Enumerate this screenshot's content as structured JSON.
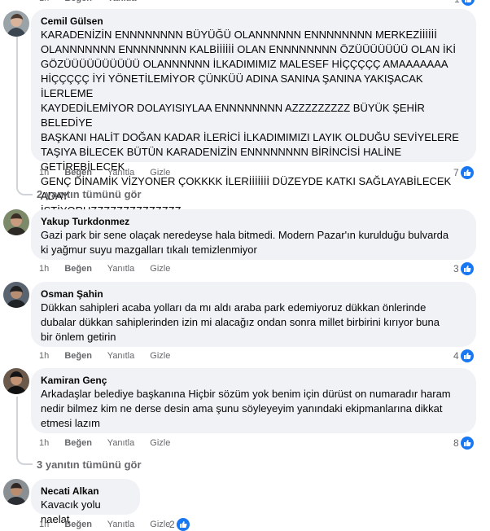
{
  "top_partial": {
    "count": "1"
  },
  "actions": {
    "like": "Beğen",
    "reply": "Yanıtla",
    "hide": "Gizle"
  },
  "comments": [
    {
      "author": "Cemil Gülsen",
      "text": "KARADENİZİN ENNNNNNNN BÜYÜĞÜ OLANNNNNN ENNNNNNNN MERKEZİİİİİİ\nOLANNNNNNN ENNNNNNNN KALBİİİİİİ OLAN ENNNNNNNN ÖZÜÜÜÜÜÜÜ OLAN İKİ\nGÖZÜÜÜÜÜÜÜÜÜÜ OLANNNNNN İLKADIMIMIZ MALESEF HİÇÇÇÇÇ AMAAAAAAA\nHİÇÇÇÇÇ İYİ YÖNETİLEMİYOR ÇÜNKÜÜ ADINA SANINA ŞANINA YAKIŞACAK İLERLEME\nKAYDEDİLEMİYOR DOLAYISIYLAA ENNNNNNNN AZZZZZZZZZ BÜYÜK ŞEHİR BELEDİYE\nBAŞKANI HALİT DOĞAN KADAR İLERİCİ İLKADIMIMIZI LAYIK OLDUĞU SEVİYELERE\nTAŞIYA BİLECEK BÜTÜN KARADENİZİN ENNNNNNNN BİRİNCİSİ HALİNE GETİREBİLECEK\nGENÇ DİNAMİK VİZYONER ÇOKKKK İLERİİİİİİİ DÜZEYDE KATKI SAĞLAYABİLECEK ADAY\nİSTİYORUZZZZZZZZZZZZZZ",
      "time": "1h",
      "reactions": "7"
    },
    {
      "author": "Yakup Turkdonmez",
      "text": "Gazi park bir sene olaçak neredeyse hala bitmedi. Modern Pazar'ın kurulduğu bulvarda\nki yağmur suyu mazgalları tıkalı temizlenmiyor",
      "time": "1h",
      "reactions": "3"
    },
    {
      "author": "Osman Şahin",
      "text": "Dükkan sahipleri acaba yolları da mı aldı araba park edemiyoruz dükkan önlerinde\ndubalar dükkan sahiplerinden izin mi alacağız ondan sonra millet birbirini kırıyor buna\nbir önlem getirin",
      "time": "1h",
      "reactions": "4"
    },
    {
      "author": "Kamiran Genç",
      "text": "Arkadaşlar belediye başkanına Hiçbir sözüm yok benim için dürüst on numaradır haram\nnedir bilmez kim ne derse desin ama şunu söyleyeyim yanındaki ekipmanlarına dikkat\netmesi lazım",
      "time": "1h",
      "reactions": "8"
    },
    {
      "author": "Necati Alkan",
      "text": "Kavacık yolu naelat",
      "time": "1h",
      "reactions": "2"
    }
  ],
  "view_replies": [
    "2 yanıtın tümünü gör",
    "3 yanıtın tümünü gör"
  ],
  "colors": {
    "bubble": "#f0f2f5",
    "meta_text": "#65676b",
    "like_blue": "#1877f2",
    "thread_line": "#d0d3d8"
  },
  "icons": {
    "like": "thumbs-up-icon"
  }
}
